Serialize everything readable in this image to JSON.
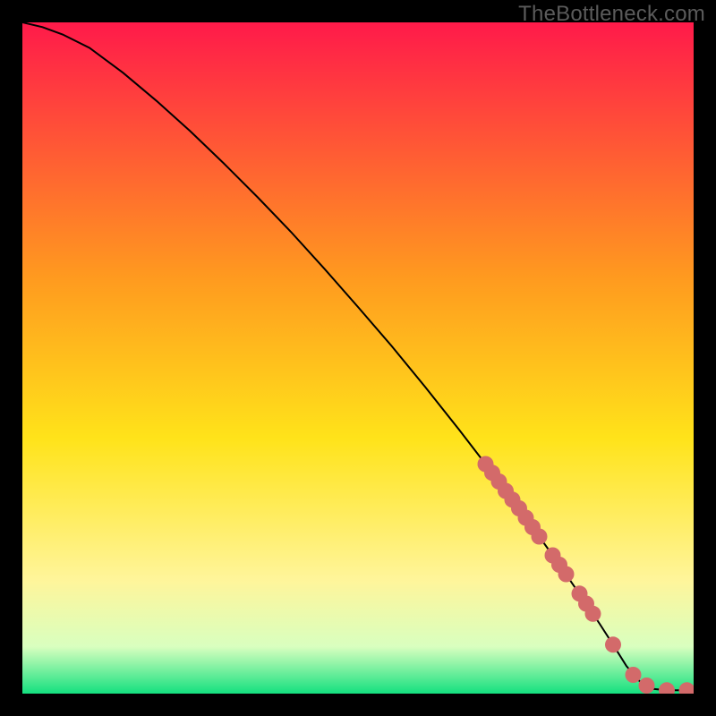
{
  "watermark": "TheBottleneck.com",
  "colors": {
    "page_bg": "#000000",
    "gradient_top": "#ff1a4a",
    "gradient_mid1": "#ff9a1f",
    "gradient_mid2": "#ffe31a",
    "gradient_mid3": "#fff59a",
    "gradient_mid4": "#d9ffbf",
    "gradient_bottom": "#14e07f",
    "line": "#000000",
    "marker_fill": "#d36a6a",
    "marker_stroke": "#b85252",
    "watermark": "#5b5b5b"
  },
  "chart_data": {
    "type": "line",
    "title": "",
    "xlabel": "",
    "ylabel": "",
    "xlim": [
      0,
      100
    ],
    "ylim": [
      0,
      100
    ],
    "series": [
      {
        "name": "curve",
        "x": [
          0,
          3,
          6,
          10,
          15,
          20,
          25,
          30,
          35,
          40,
          45,
          50,
          55,
          60,
          65,
          70,
          75,
          80,
          82,
          84,
          86,
          88,
          90,
          92,
          94,
          96,
          98,
          100
        ],
        "y": [
          100,
          99.3,
          98.2,
          96.2,
          92.5,
          88.3,
          83.8,
          79.0,
          74.0,
          68.8,
          63.3,
          57.6,
          51.8,
          45.7,
          39.4,
          32.9,
          26.2,
          19.2,
          16.3,
          13.4,
          10.4,
          7.3,
          4.1,
          1.8,
          0.7,
          0.5,
          0.5,
          0.5
        ]
      }
    ],
    "markers": {
      "name": "highlighted-points",
      "x": [
        69,
        70,
        71,
        72,
        73,
        74,
        75,
        76,
        77,
        79,
        80,
        81,
        83,
        84,
        85,
        88,
        91,
        93,
        96,
        99
      ],
      "y": [
        34.2,
        32.9,
        31.6,
        30.2,
        28.9,
        27.6,
        26.2,
        24.8,
        23.4,
        20.6,
        19.2,
        17.8,
        14.9,
        13.4,
        11.9,
        7.3,
        2.8,
        1.2,
        0.5,
        0.5
      ]
    }
  }
}
